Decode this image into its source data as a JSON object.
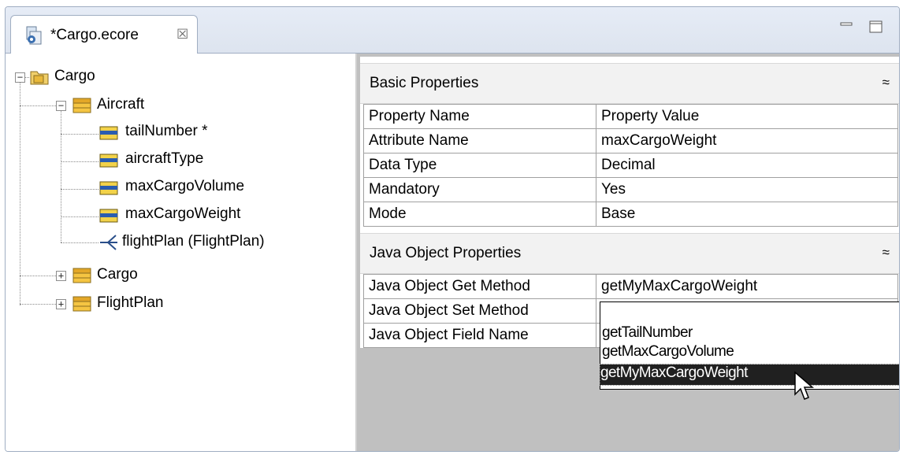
{
  "editor": {
    "tab_title": "*Cargo.ecore",
    "close_glyph": "☒"
  },
  "tree": {
    "root": "Cargo",
    "aircraft": "Aircraft",
    "attributes": [
      "tailNumber *",
      "aircraftType",
      "maxCargoVolume",
      "maxCargoWeight"
    ],
    "reference": "flightPlan (FlightPlan)",
    "cargo_class": "Cargo",
    "flightplan_class": "FlightPlan"
  },
  "basic": {
    "title": "Basic Properties",
    "header": [
      "Property Name",
      "Property Value"
    ],
    "rows": [
      [
        "Attribute Name",
        "maxCargoWeight"
      ],
      [
        "Data Type",
        "Decimal"
      ],
      [
        "Mandatory",
        "Yes"
      ],
      [
        "Mode",
        "Base"
      ]
    ]
  },
  "java": {
    "title": "Java Object Properties",
    "rows": [
      [
        "Java Object Get Method",
        "getMyMaxCargoWeight"
      ],
      [
        "Java Object Set Method",
        ""
      ],
      [
        "Java Object Field Name",
        ""
      ]
    ]
  },
  "dropdown": {
    "options": [
      "getTailNumber",
      "getMaxCargoVolume",
      "getMyMaxCargoWeight"
    ],
    "selected": "getMyMaxCargoWeight"
  },
  "colors": {
    "selection_bg": "#202020",
    "class_icon": "#f5c542",
    "attr_icon": "#f2d24a"
  }
}
